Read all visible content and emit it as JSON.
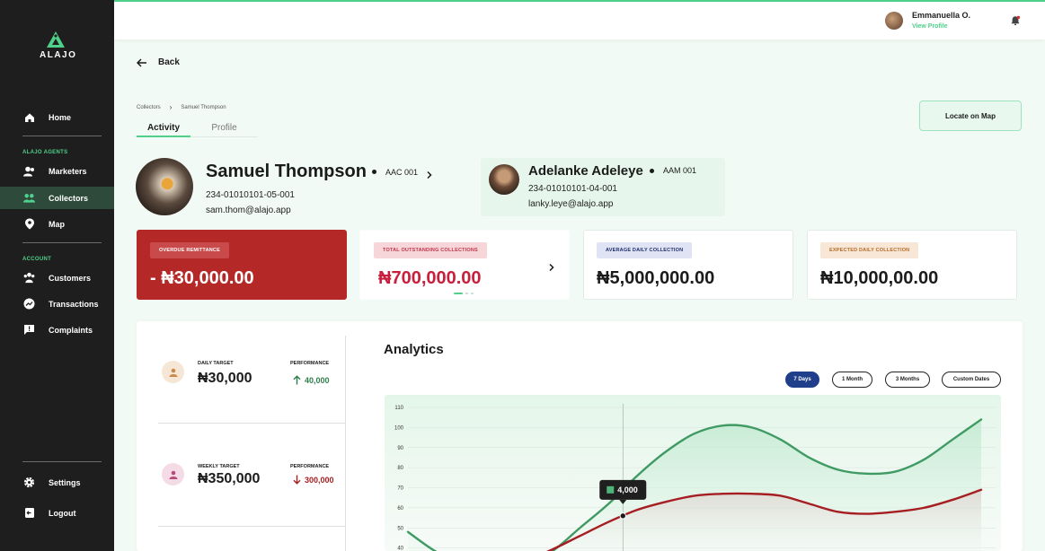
{
  "brand": {
    "name": "ALAJO"
  },
  "sidebar": {
    "items": [
      {
        "label": "Home",
        "icon": "home-icon"
      },
      {
        "label": "Marketers",
        "icon": "people-icon"
      },
      {
        "label": "Collectors",
        "icon": "collectors-icon",
        "active": true
      },
      {
        "label": "Map",
        "icon": "map-pin-icon"
      },
      {
        "label": "Customers",
        "icon": "customers-icon"
      },
      {
        "label": "Transactions",
        "icon": "transactions-icon"
      },
      {
        "label": "Complaints",
        "icon": "complaints-icon"
      },
      {
        "label": "Settings",
        "icon": "gear-icon"
      },
      {
        "label": "Logout",
        "icon": "logout-icon"
      }
    ],
    "section_agents": "ALAJO AGENTS",
    "section_account": "ACCOUNT"
  },
  "topbar": {
    "user_name": "Emmanuella O.",
    "user_link": "View Profile"
  },
  "back_label": "Back",
  "breadcrumb": {
    "parent": "Collectors",
    "current": "Samuel Thompson"
  },
  "tabs": [
    "Activity",
    "Profile"
  ],
  "locate_button": "Locate on Map",
  "collector": {
    "name": "Samuel Thompson",
    "code": "AAC 001",
    "phone": "234-01010101-05-001",
    "email": "sam.thom@alajo.app"
  },
  "manager": {
    "name": "Adelanke Adeleye",
    "code": "AAM 001",
    "phone": "234-01010101-04-001",
    "email": "lanky.leye@alajo.app"
  },
  "stats": {
    "overdue": {
      "label": "OVERDUE REMITTANCE",
      "value": "- ₦30,000.00"
    },
    "outstanding": {
      "label": "TOTAL OUTSTANDING COLLECTIONS",
      "value": "₦700,000.00"
    },
    "average": {
      "label": "AVERAGE DAILY COLLECTION",
      "value": "₦5,000,000.00"
    },
    "expected": {
      "label": "EXPECTED DAILY COLLECTION",
      "value": "₦10,000,00.00"
    }
  },
  "targets": {
    "daily": {
      "label": "DAILY TARGET",
      "value": "₦30,000",
      "perf_label": "PERFORMANCE",
      "perf_value": "40,000",
      "direction": "up"
    },
    "weekly": {
      "label": "WEEKLY TARGET",
      "value": "₦350,000",
      "perf_label": "PERFORMANCE",
      "perf_value": "300,000",
      "direction": "down"
    }
  },
  "analytics": {
    "title": "Analytics",
    "ranges": [
      "7 Days",
      "1 Month",
      "3 Months",
      "Custom Dates"
    ],
    "selected_range": "7 Days",
    "tooltip": "4,000"
  },
  "colors": {
    "accent": "#4fd18b",
    "overdue": "#b52828",
    "outstanding": "#c71f3c",
    "series_green": "#3f9a63",
    "series_red": "#a61e22"
  },
  "chart_data": {
    "type": "line",
    "ylim": [
      30,
      110
    ],
    "yticks": [
      "110",
      "100",
      "90",
      "80",
      "70",
      "60",
      "50",
      "40",
      "30"
    ],
    "x": [
      0,
      1,
      2,
      3,
      4,
      5,
      6,
      7,
      8,
      9,
      10,
      11,
      12,
      13,
      14,
      15,
      16,
      17,
      18,
      19,
      20
    ],
    "series": [
      {
        "values": [
          48,
          38,
          32,
          30,
          31,
          38,
          50,
          62,
          76,
          88,
          97,
          101,
          100,
          94,
          85,
          79,
          77,
          78,
          84,
          94,
          104
        ]
      },
      {
        "values": [
          38,
          33,
          30,
          30,
          33,
          39,
          46,
          53,
          59,
          63,
          66,
          67,
          67,
          66,
          62,
          58,
          57,
          58,
          60,
          64,
          69
        ]
      }
    ]
  }
}
